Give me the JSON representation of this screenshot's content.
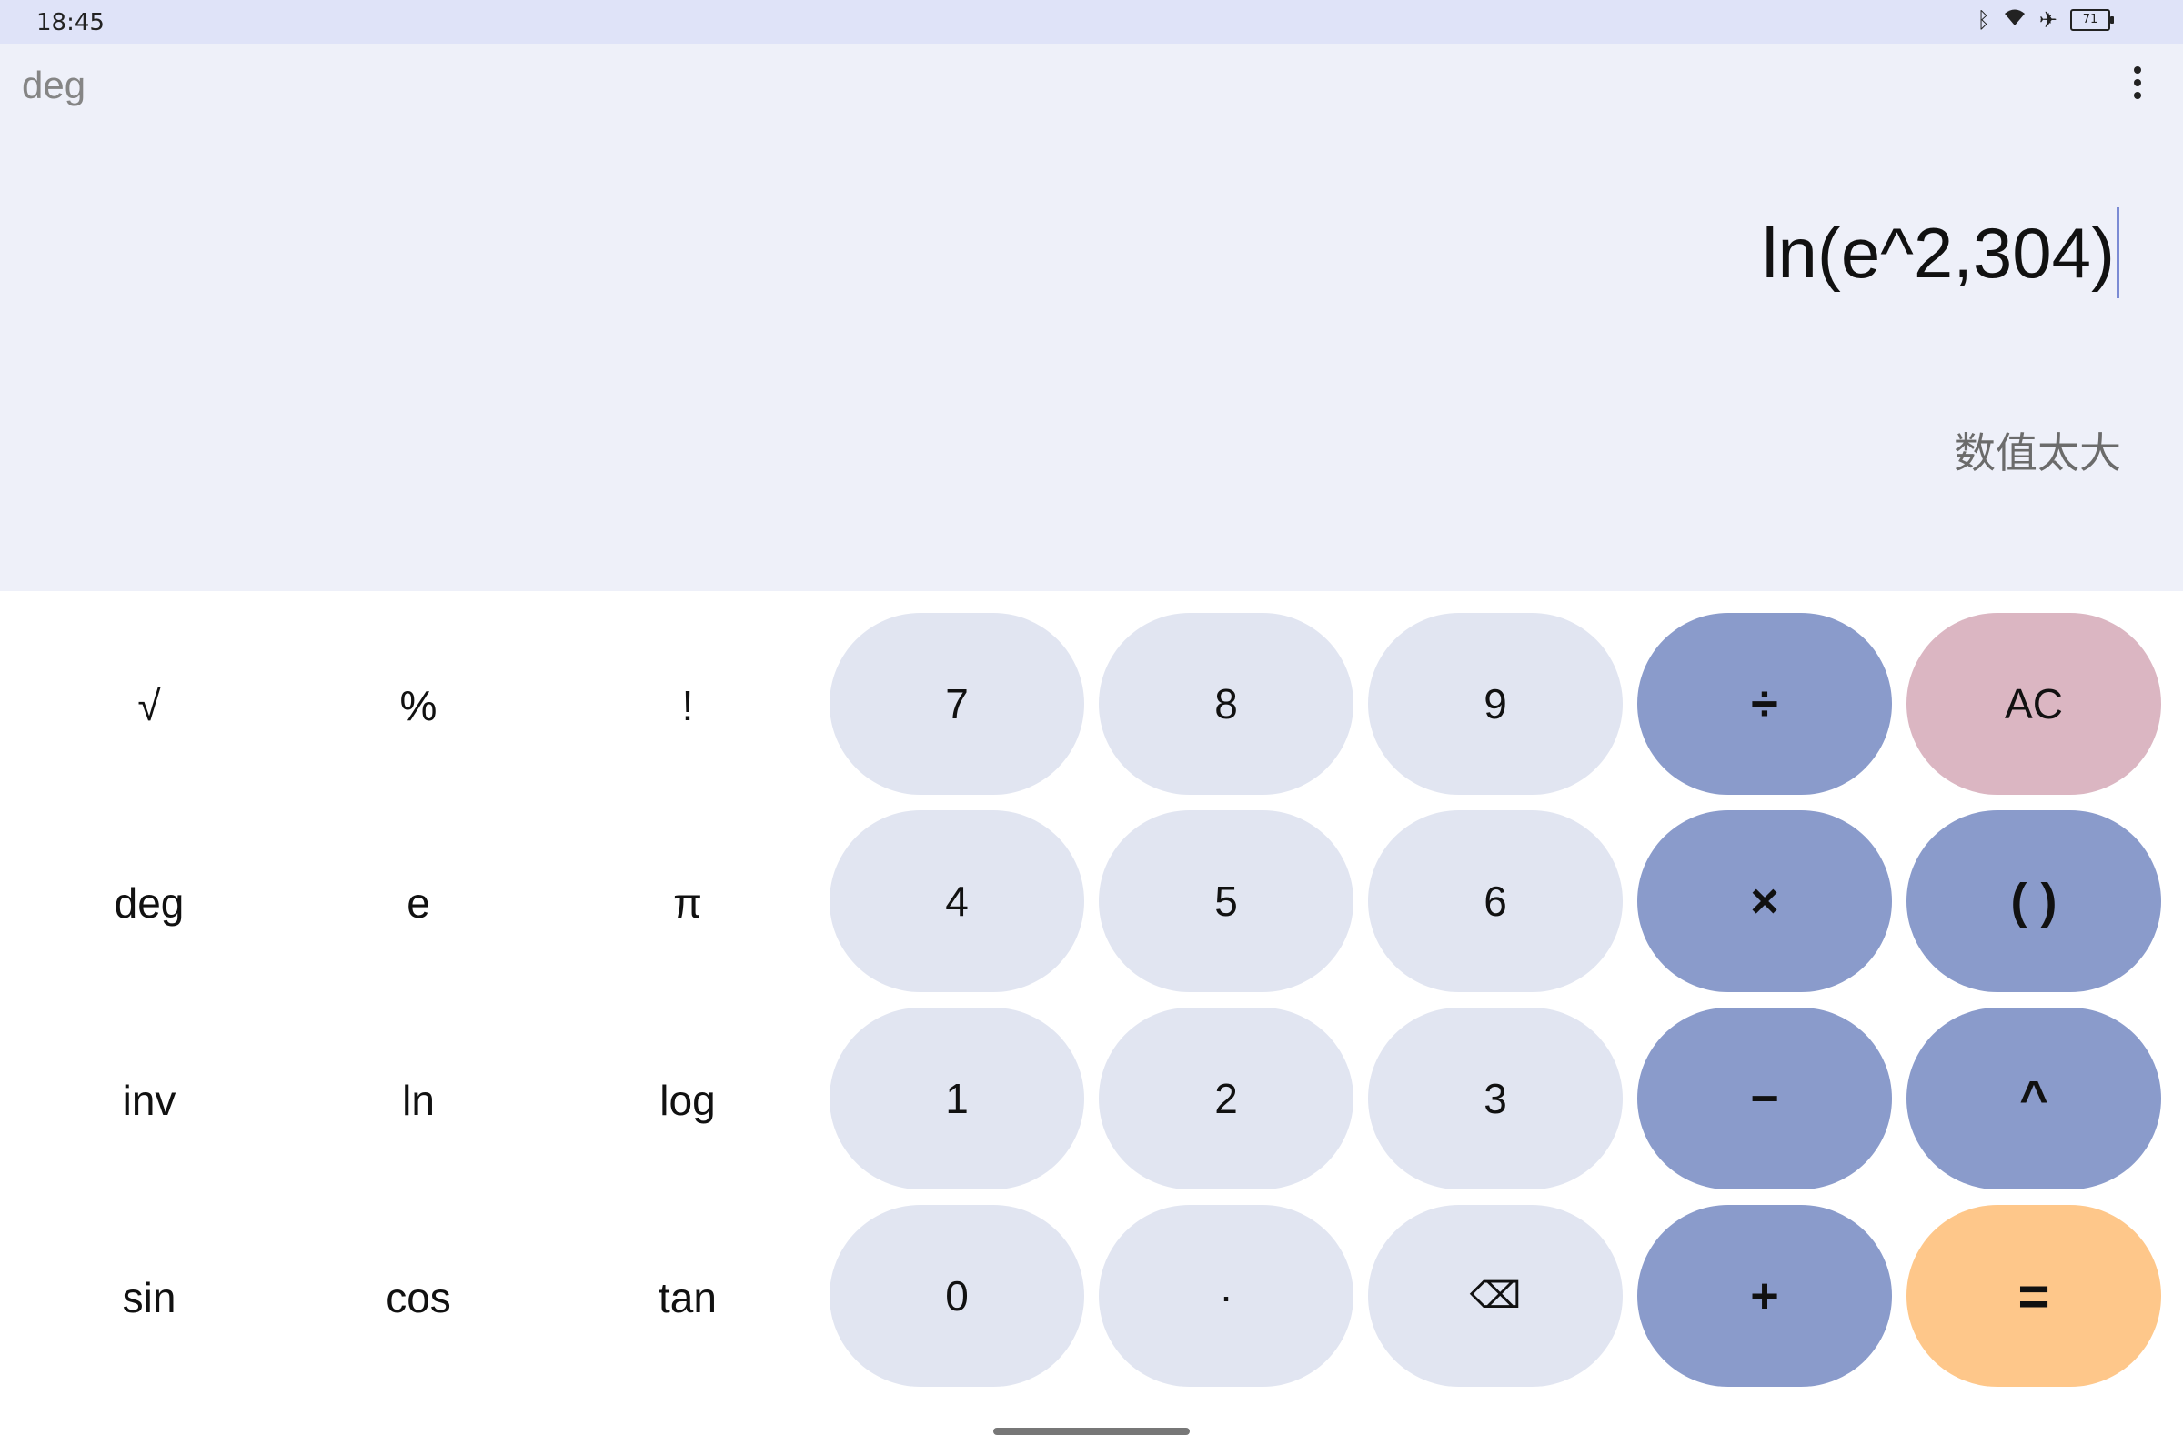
{
  "status_bar": {
    "time": "18:45",
    "icons": [
      "bluetooth-icon",
      "wifi-icon",
      "airplane-icon",
      "battery-icon"
    ],
    "battery_level": "71"
  },
  "display": {
    "mode": "deg",
    "formula": "ln(e^2,304)",
    "result": "数值太大"
  },
  "keypad": {
    "scientific": [
      [
        "√",
        "%",
        "!"
      ],
      [
        "deg",
        "e",
        "π"
      ],
      [
        "inv",
        "ln",
        "log"
      ],
      [
        "sin",
        "cos",
        "tan"
      ]
    ],
    "digits": [
      [
        "7",
        "8",
        "9"
      ],
      [
        "4",
        "5",
        "6"
      ],
      [
        "1",
        "2",
        "3"
      ],
      [
        "0",
        "·",
        "⌫"
      ]
    ],
    "operators": [
      "÷",
      "×",
      "−",
      "+"
    ],
    "right_column": [
      "AC",
      "( )",
      "^",
      "="
    ]
  },
  "colors": {
    "status_bar": "#dfe3f8",
    "display_bg": "#eef0f9",
    "digit_key": "#e1e5f1",
    "operator_key": "#8a9bcb",
    "clear_key": "#dbb6c2",
    "equals_key": "#fec78a"
  }
}
